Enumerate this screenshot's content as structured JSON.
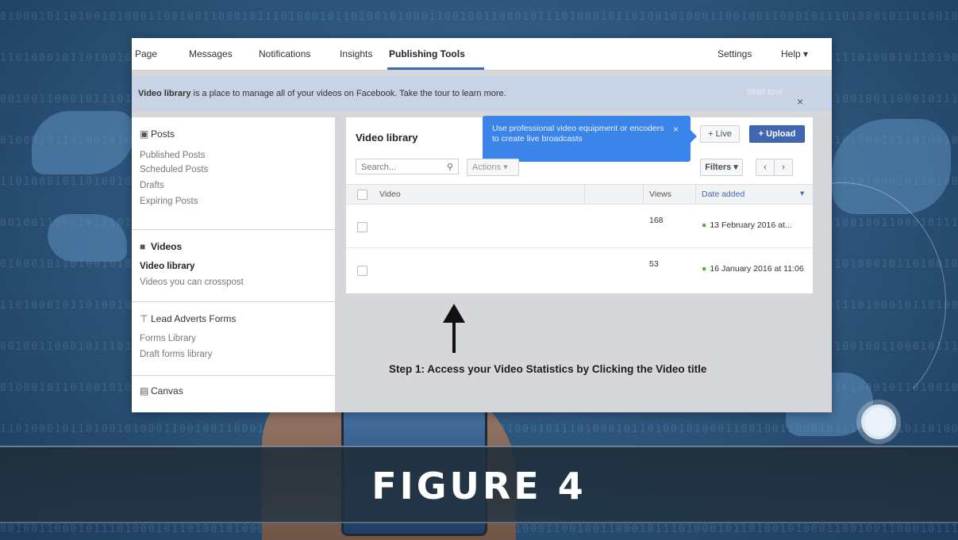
{
  "topnav": {
    "items": [
      "Page",
      "Messages",
      "Notifications",
      "Insights",
      "Publishing Tools"
    ],
    "right": [
      "Settings",
      "Help ▾"
    ]
  },
  "infobar": {
    "bold": "Video library",
    "text": " is a place to manage all of your videos on Facebook. Take the tour to learn more.",
    "tour": "Start tour",
    "close": "×"
  },
  "sidebar": {
    "posts": {
      "head": "Posts",
      "items": [
        "Published Posts",
        "Scheduled Posts",
        "Drafts",
        "Expiring Posts"
      ]
    },
    "videos": {
      "head": "Videos",
      "items": [
        "Video library",
        "Videos you can crosspost"
      ]
    },
    "forms": {
      "head": "Lead Adverts Forms",
      "items": [
        "Forms Library",
        "Draft forms library"
      ]
    },
    "canvas": {
      "head": "Canvas"
    }
  },
  "main": {
    "title": "Video library",
    "tooltip": "Use professional video equipment or encoders to create live broadcasts",
    "tooltip_close": "×",
    "live_btn": "+ Live",
    "upload_btn": "+ Upload",
    "search_placeholder": "Search...",
    "actions": "Actions ▾",
    "filters": "Filters ▾",
    "columns": {
      "video": "Video",
      "views": "Views",
      "date": "Date added"
    },
    "rows": [
      {
        "views": "168",
        "date": "13 February 2016 at..."
      },
      {
        "views": "53",
        "date": "16 January 2016 at 11:06"
      }
    ]
  },
  "caption": "Step 1: Access your Video Statistics by Clicking the Video title",
  "banner": "FIGURE  4",
  "binary_rows": [
    "0100010110100101000110010011000101110100010110100101000110010011000101110100010110100101000110010011000101110100010110100101000110010011000101",
    "1101000101101001010001100100110001011101000101101001010001100100110001011101000101101001010001100100110001011101000101101001010001100100110001",
    "0010011000101110100010110100101000110010011000101110100010110100101000110010011000101110100010110100101000110010011000101110100010110100101000"
  ]
}
